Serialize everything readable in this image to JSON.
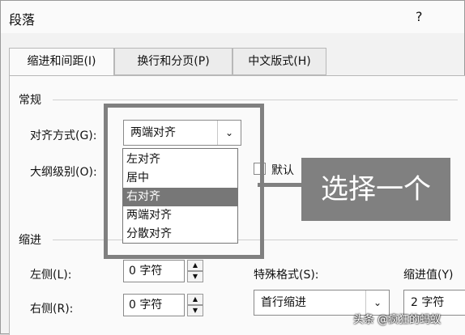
{
  "dialog": {
    "title": "段落",
    "help": "?"
  },
  "tabs": [
    {
      "label": "缩进和间距(I)",
      "active": true
    },
    {
      "label": "换行和分页(P)",
      "active": false
    },
    {
      "label": "中文版式(H)",
      "active": false
    }
  ],
  "general": {
    "section": "常规",
    "alignment_label": "对齐方式(G):",
    "alignment_value": "两端对齐",
    "outline_label": "大纲级别(O):",
    "default_label": "默认"
  },
  "dropdown": {
    "options": [
      "左对齐",
      "居中",
      "右对齐",
      "两端对齐",
      "分散对齐"
    ],
    "selected": "右对齐"
  },
  "annotation": {
    "text": "选择一个"
  },
  "indent": {
    "section": "缩进",
    "left_label": "左侧(L):",
    "left_value": "0 字符",
    "right_label": "右侧(R):",
    "right_value": "0 字符",
    "special_label": "特殊格式(S):",
    "special_value": "首行缩进",
    "by_label": "缩进值(Y)",
    "by_value": "2 字符"
  },
  "watermark": "头条 @疯狂的蚂蚁"
}
